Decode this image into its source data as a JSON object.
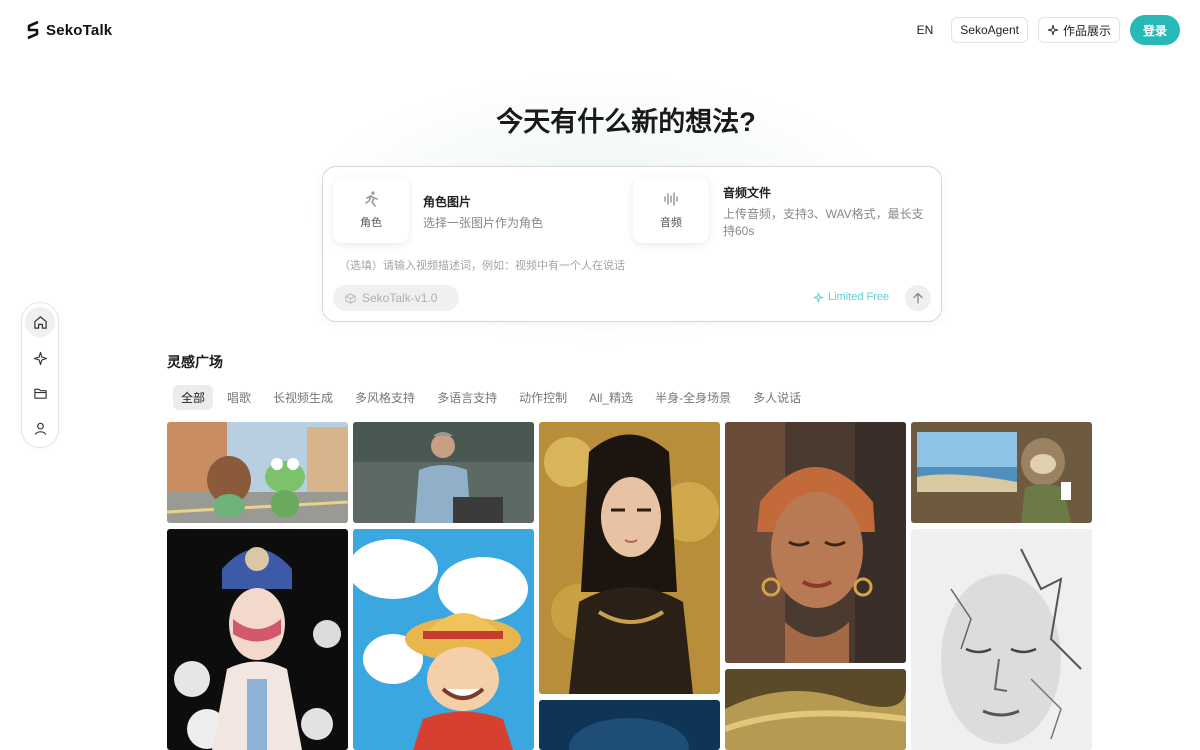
{
  "brand": {
    "name": "SekoTalk"
  },
  "nav": {
    "language": "EN",
    "agent_label": "SekoAgent",
    "showcase_label": "作品展示",
    "login_label": "登录"
  },
  "hero": {
    "title": "今天有什么新的想法?"
  },
  "composer": {
    "role_tile_label": "角色",
    "role_title": "角色图片",
    "role_desc": "选择一张图片作为角色",
    "audio_tile_label": "音频",
    "audio_title": "音频文件",
    "audio_desc": "上传音频，支持3、WAV格式，最长支持60s",
    "prompt_placeholder": "（选填）请输入视频描述词，例如：视频中有一个人在说话",
    "model": "SekoTalk-v1.0",
    "limited_label": "Limited Free"
  },
  "sidenav": {
    "items": [
      "home-icon",
      "sparkle-icon",
      "folder-icon",
      "user-icon"
    ]
  },
  "inspiration": {
    "title": "灵感广场",
    "tabs": [
      "全部",
      "唱歌",
      "长视频生成",
      "多风格支持",
      "多语言支持",
      "动作控制",
      "All_精选",
      "半身-全身场景",
      "多人说话"
    ],
    "active_tab": "全部"
  },
  "colors": {
    "accent": "#26b9b6",
    "limited": "#5fcfd0"
  }
}
